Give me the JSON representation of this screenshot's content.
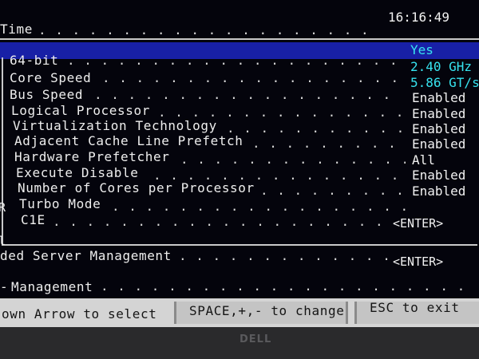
{
  "header": {
    "time_label": "Time",
    "time_value": "16:16:49"
  },
  "settings": [
    {
      "label": "64-bit",
      "value": "Yes",
      "highlight": true,
      "value_color": "cyan"
    },
    {
      "label": "Core Speed",
      "value": "2.40 GHz",
      "value_color": "cyan"
    },
    {
      "label": "Bus Speed",
      "value": "5.86 GT/s",
      "value_color": "cyan"
    },
    {
      "label": "Logical Processor",
      "value": "Enabled"
    },
    {
      "label": "Virtualization Technology",
      "value": "Enabled"
    },
    {
      "label": "Adjacent Cache Line Prefetch",
      "value": "Enabled"
    },
    {
      "label": "Hardware Prefetcher",
      "value": "Enabled"
    },
    {
      "label": "Execute Disable",
      "value": "All"
    },
    {
      "label": "Number of Cores per Processor",
      "value": "Enabled"
    },
    {
      "label": "Turbo Mode",
      "value": "Enabled"
    },
    {
      "label": "C1E",
      "value": "<ENTER>"
    }
  ],
  "menu": [
    {
      "label": "ded Server Management",
      "value": "<ENTER>"
    },
    {
      "label": "Management",
      "value": ""
    }
  ],
  "left_edge_glyphs": [
    "R",
    "l"
  ],
  "footer": {
    "left": "own Arrow to select",
    "middle": "SPACE,+,- to change",
    "right": "ESC to exit"
  },
  "bezel": {
    "logo_text": "DELL"
  },
  "colors": {
    "background": "#04040c",
    "highlight": "#1820a6",
    "cyan_value": "#37e3ef",
    "text": "#eeeeee",
    "footer_bar": "#d4d4d4"
  }
}
